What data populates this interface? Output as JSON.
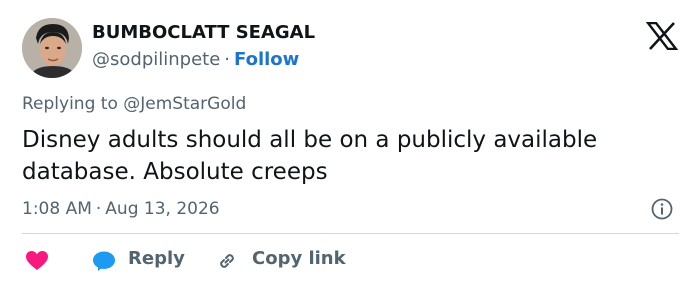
{
  "author": {
    "display_name": "BUMBOCLATT SEAGAL",
    "handle": "@sodpilinpete",
    "separator": "·",
    "follow_label": "Follow"
  },
  "reply_context": {
    "prefix": "Replying to",
    "mention": "@JemStarGold"
  },
  "tweet": {
    "text": "Disney adults should all be on a publicly available database. Absolute creeps"
  },
  "meta": {
    "time": "1:08 AM",
    "separator": "·",
    "date": "Aug 13, 2026"
  },
  "actions": {
    "reply_label": "Reply",
    "copy_link_label": "Copy link"
  },
  "icons": {
    "brand": "x-logo-icon",
    "info": "info-icon",
    "like": "heart-icon",
    "reply": "speech-bubble-icon",
    "copy": "link-icon"
  },
  "colors": {
    "text": "#0f1419",
    "secondary": "#536471",
    "link": "#1d74d0",
    "heart": "#f91880",
    "reply_bubble": "#1d9bf0",
    "divider": "#cfd9de"
  }
}
